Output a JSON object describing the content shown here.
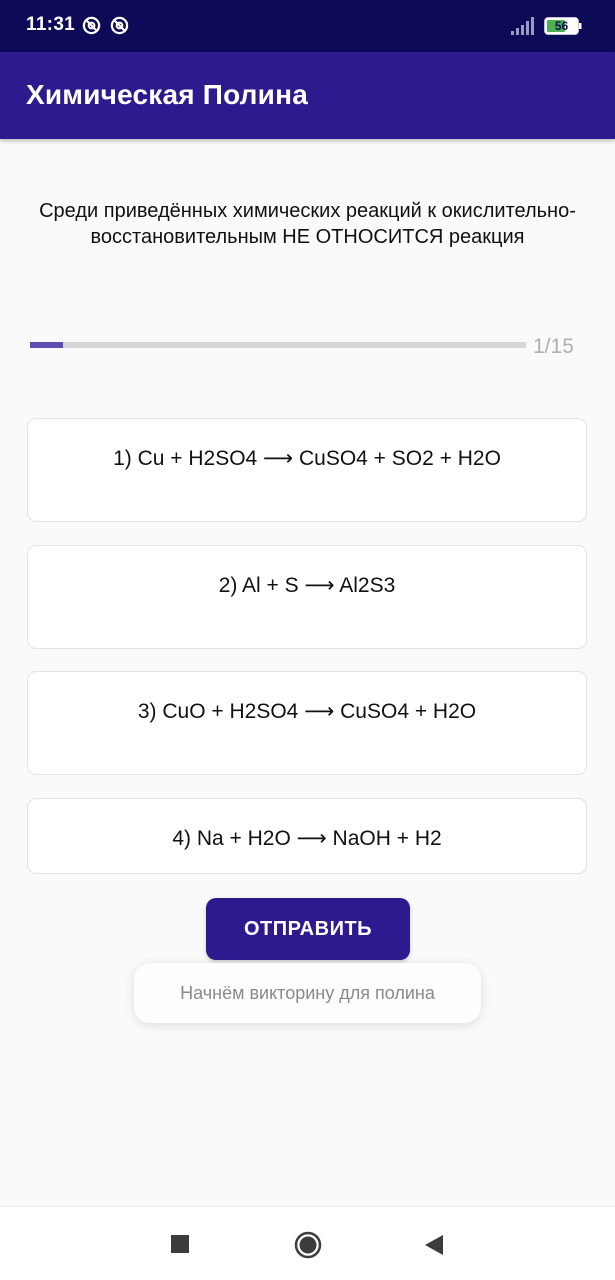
{
  "status_bar": {
    "time": "11:31",
    "battery": "56"
  },
  "app_bar": {
    "title": "Химическая Полина"
  },
  "question": {
    "text": "Среди приведённых химических реакций к окислительно-восстановительным НЕ ОТНОСИТСЯ реакция"
  },
  "progress": {
    "current": 1,
    "total": 15,
    "label": "1/15",
    "fill_fraction": 0.067
  },
  "options": [
    {
      "label": "1) Cu + H2SO4 ⟶ CuSO4 + SO2 + H2O"
    },
    {
      "label": "2) Al + S ⟶ Al2S3"
    },
    {
      "label": "3) CuO + H2SO4 ⟶ CuSO4 + H2O"
    },
    {
      "label": "4) Na + H2O ⟶ NaOH + H2"
    }
  ],
  "submit_label": "ОТПРАВИТЬ",
  "toast": {
    "text": "Начнём викторину для полина"
  },
  "colors": {
    "status_bar": "#0d0a57",
    "app_bar": "#2e1a8f",
    "progress_fill": "#5a4fb0"
  },
  "icons": {
    "status": [
      "at-sign-icon",
      "at-sign-icon",
      "signal-icon",
      "battery-icon"
    ],
    "nav": [
      "recents-square-icon",
      "home-circle-icon",
      "back-triangle-icon"
    ]
  }
}
